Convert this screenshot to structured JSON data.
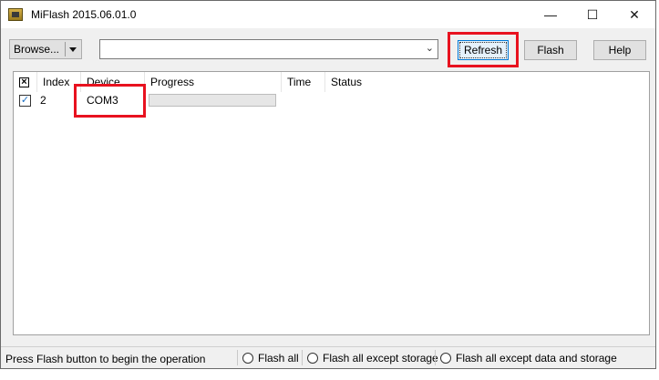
{
  "window": {
    "title": "MiFlash 2015.06.01.0",
    "icon": "miflash-app-icon",
    "controls": {
      "minimize": "—",
      "maximize": "☐",
      "close": "✕"
    }
  },
  "toolbar": {
    "browse_label": "Browse...",
    "path_value": "",
    "refresh_label": "Refresh",
    "flash_label": "Flash",
    "help_label": "Help"
  },
  "table": {
    "columns": [
      "Index",
      "Device",
      "Progress",
      "Time",
      "Status"
    ],
    "rows": [
      {
        "checked": true,
        "index": "2",
        "device": "COM3",
        "progress": 0,
        "time": "",
        "status": ""
      }
    ]
  },
  "statusbar": {
    "message": "Press Flash button to begin the operation",
    "options": [
      "Flash all",
      "Flash all except storage",
      "Flash all except data and storage"
    ],
    "selected": null
  },
  "colors": {
    "highlight": "#e8121f",
    "accent": "#0078d7",
    "checkmark": "#1a6fc4"
  }
}
